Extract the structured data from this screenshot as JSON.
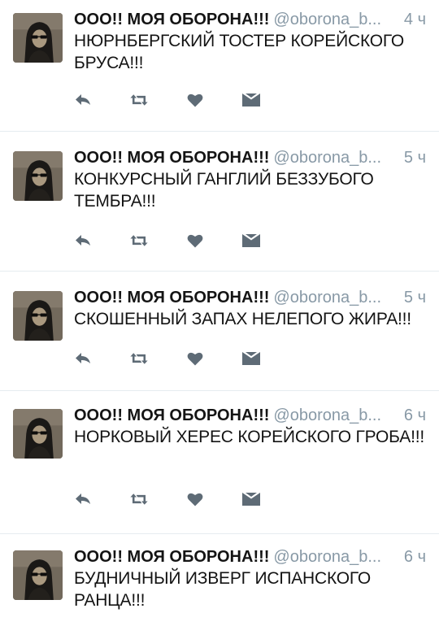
{
  "colors": {
    "text": "#141414",
    "secondary": "#8899a6",
    "icon": "#5e6b76",
    "divider": "#e6ecf0"
  },
  "icons": [
    "reply-icon",
    "retweet-icon",
    "like-icon",
    "direct-message-icon"
  ],
  "tweets": [
    {
      "name": "ООО!! МОЯ ОБОРОНА!!!",
      "handle": "@oborona_b...",
      "time": "4 ч",
      "text": "НЮРНБЕРГСКИЙ ТОСТЕР КОРЕЙСКОГО БРУСА!!!"
    },
    {
      "name": "ООО!! МОЯ ОБОРОНА!!!",
      "handle": "@oborona_b...",
      "time": "5 ч",
      "text": "КОНКУРСНЫЙ ГАНГЛИЙ БЕЗЗУБОГО ТЕМБРА!!!"
    },
    {
      "name": "ООО!! МОЯ ОБОРОНА!!!",
      "handle": "@oborona_b...",
      "time": "5 ч",
      "text": "СКОШЕННЫЙ ЗАПАХ НЕЛЕПОГО ЖИРА!!!"
    },
    {
      "name": "ООО!! МОЯ ОБОРОНА!!!",
      "handle": "@oborona_b...",
      "time": "6 ч",
      "text": "НОРКОВЫЙ ХЕРЕС КОРЕЙСКОГО ГРОБА!!!"
    },
    {
      "name": "ООО!! МОЯ ОБОРОНА!!!",
      "handle": "@oborona_b...",
      "time": "6 ч",
      "text": "БУДНИЧНЫЙ ИЗВЕРГ ИСПАНСКОГО РАНЦА!!!"
    }
  ]
}
